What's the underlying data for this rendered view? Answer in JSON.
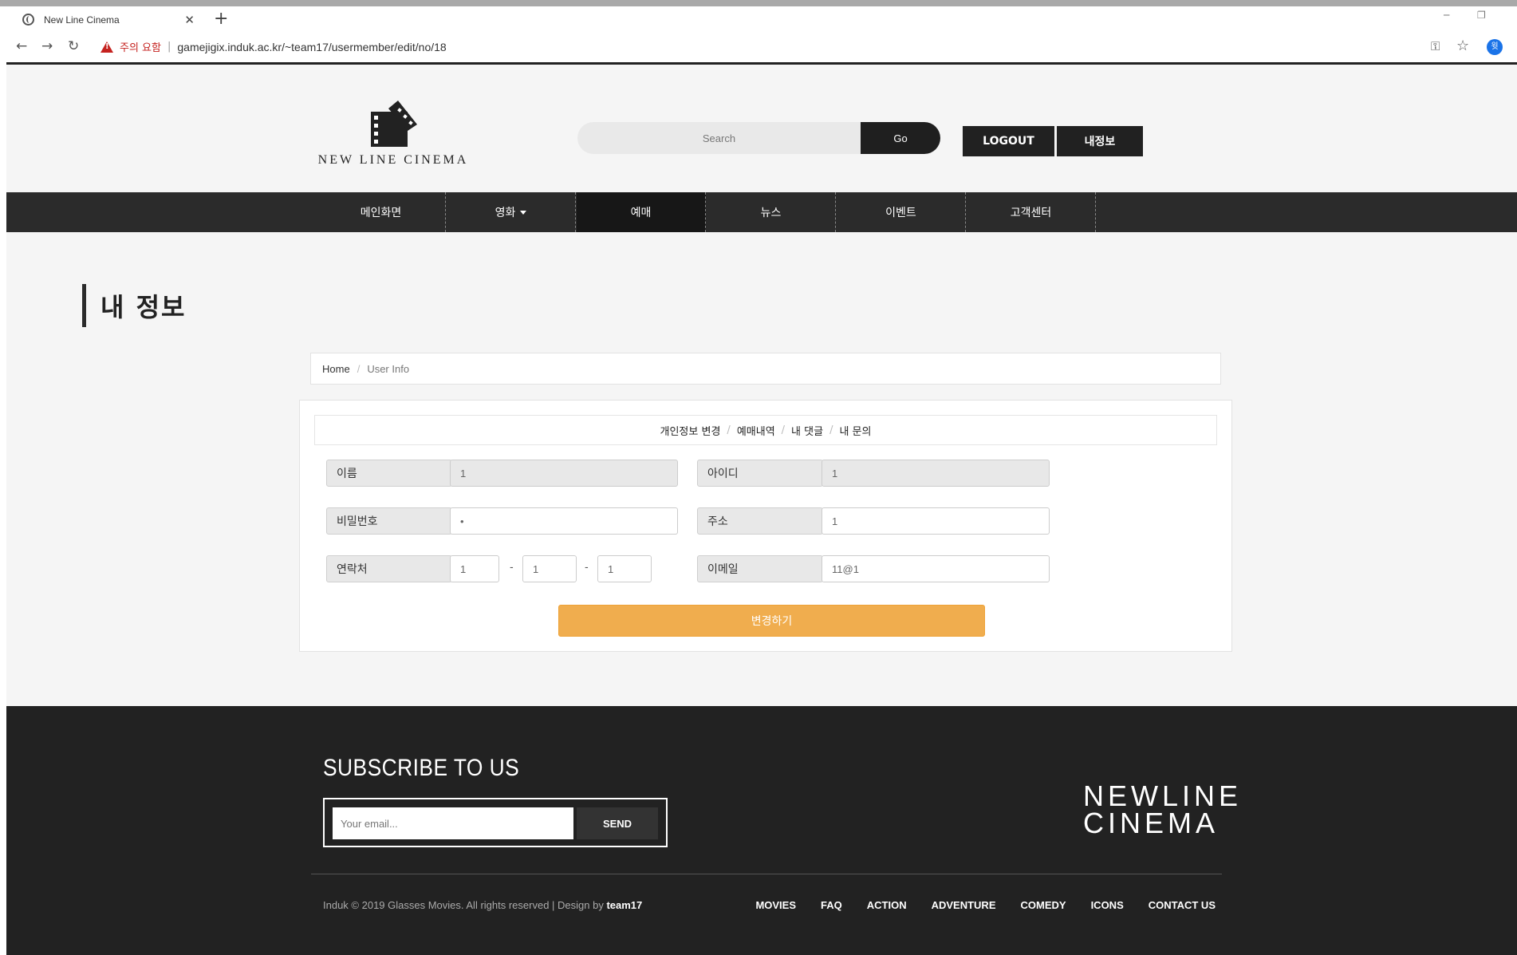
{
  "browser": {
    "tab_title": "New Line Cinema",
    "tab_close": "✕",
    "new_tab": "+",
    "security_label": "주의 요함",
    "url": "gamejigix.induk.ac.kr/~team17/usermember/edit/no/18",
    "profile_initial": "윗",
    "back": "←",
    "forward": "→",
    "reload": "↻",
    "key": "⚿",
    "star": "☆",
    "minimize": "─",
    "restore": "❐"
  },
  "header": {
    "logo_text": "NEW LINE CINEMA",
    "search_placeholder": "Search",
    "search_button": "Go",
    "logout_button": "LOGOUT",
    "myinfo_button": "내정보"
  },
  "nav": {
    "items": [
      {
        "label": "메인화면"
      },
      {
        "label": "영화"
      },
      {
        "label": "예매"
      },
      {
        "label": "뉴스"
      },
      {
        "label": "이벤트"
      },
      {
        "label": "고객센터"
      }
    ]
  },
  "page": {
    "title": "내 정보",
    "breadcrumb": {
      "home": "Home",
      "separator": "/",
      "current": "User Info"
    }
  },
  "subnav": {
    "items": [
      "개인정보 변경",
      "예매내역",
      "내 댓글",
      "내 문의"
    ],
    "separator": "/"
  },
  "form": {
    "name_label": "이름",
    "name_value": "1",
    "id_label": "아이디",
    "id_value": "1",
    "password_label": "비밀번호",
    "password_value": "•",
    "address_label": "주소",
    "address_value": "1",
    "phone_label": "연락처",
    "phone_1": "1",
    "phone_2": "1",
    "phone_3": "1",
    "phone_dash": "-",
    "email_label": "이메일",
    "email_value": "11@1",
    "submit": "변경하기"
  },
  "footer": {
    "subscribe_title": "SUBSCRIBE TO US",
    "email_placeholder": "Your email...",
    "send_button": "SEND",
    "logo_line1": "NEWLINE",
    "logo_line2": "CINEMA",
    "copyright_prefix": "Induk © 2019 Glasses Movies. All rights reserved | Design by ",
    "copyright_team": "team17",
    "links": [
      "MOVIES",
      "FAQ",
      "ACTION",
      "ADVENTURE",
      "COMEDY",
      "ICONS",
      "CONTACT US"
    ]
  }
}
